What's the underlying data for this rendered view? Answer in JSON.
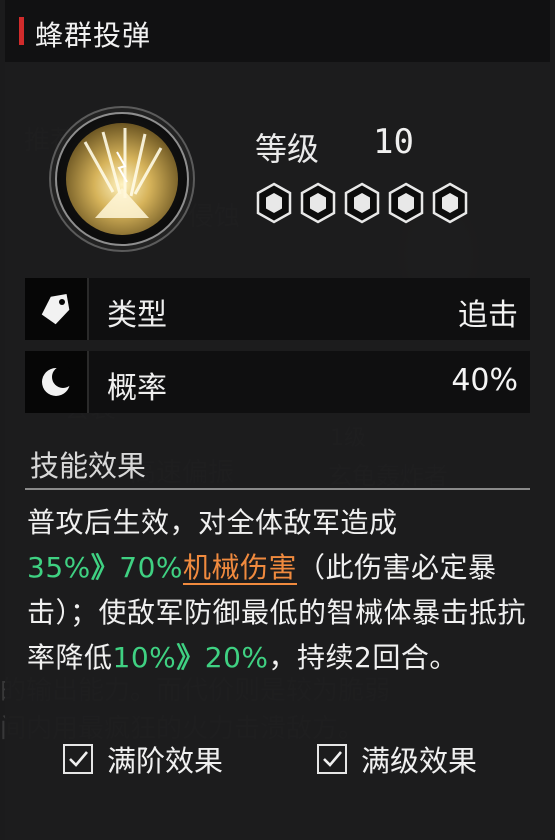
{
  "header": {
    "title": "蜂群投弹"
  },
  "skill": {
    "level_label": "等级",
    "level_value": "10",
    "icon": "swarm-bomb-skill-icon"
  },
  "stats": {
    "type": {
      "label": "类型",
      "value": "追击",
      "icon": "tag-icon"
    },
    "chance": {
      "label": "概率",
      "value": "40%",
      "icon": "moon-icon"
    }
  },
  "effect": {
    "title": "技能效果",
    "p1": "普攻后生效，对全体敌军造成",
    "v1_from": "35%",
    "v1_to": "70%",
    "dmg": "机械伤害",
    "p2": "（此伤害必定暴击）；使敌军防御最低的智械体暴击抵抗率降低",
    "v2_from": "10%",
    "v2_to": "20%",
    "p3": "，持续2回合。",
    "arrow": "》"
  },
  "toggles": {
    "full_tier": {
      "label": "满阶效果",
      "checked": true
    },
    "full_level": {
      "label": "满级效果",
      "checked": true
    }
  },
  "background": {
    "b1": "机构 +10%",
    "b2": "侦查",
    "b3": "推荐",
    "b4": "侵蚀",
    "b5": "锋旋",
    "b6": "套装",
    "b7": "1级",
    "b8": "玄龟轰炸者",
    "b9": "高速偏振",
    "b10": "的输出能力。而代价则是较为脆弱",
    "b11": "间内用最疯狂的火力击溃敌方。"
  },
  "colors": {
    "accent_red": "#d12b2b",
    "highlight_green": "#3fd182",
    "damage_orange": "#f08a3e"
  }
}
